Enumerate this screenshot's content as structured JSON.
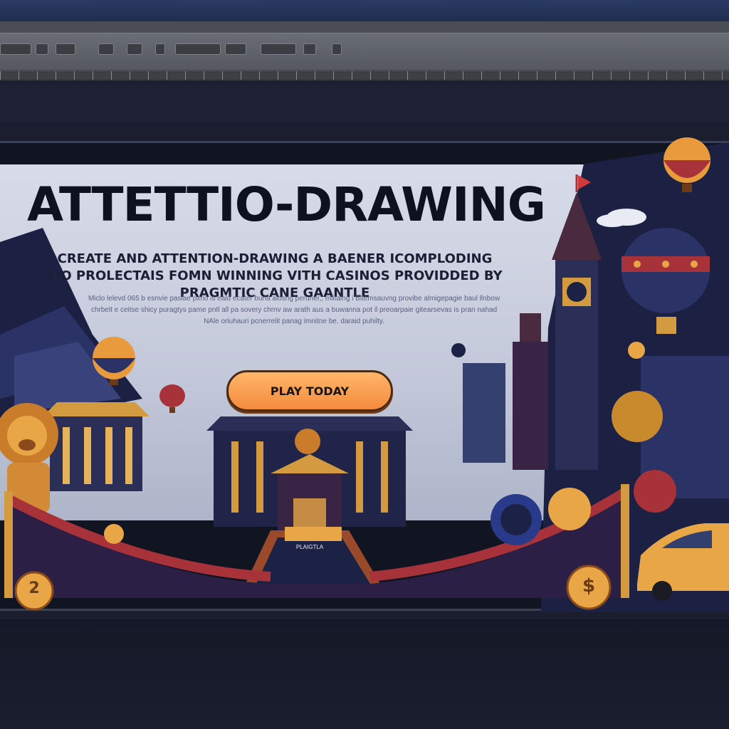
{
  "banner": {
    "headline": "ATTETTIO-DRAWING",
    "subhead": "CREATE AND ATTENTION-DRAWING A BAENER ICOMPLODING TIO PROLECTAIS FOMN WINNING VITH CASINOS PROVIDDED BY PRAGMTIC CANE GAANTLE",
    "body_copy": "Miclo lelevd 065 b esnvie pasiae pxrio is eald ecater buna alosng peruner,, mlitaing i Bitemsauvng provibe almigepagie baul llnbow chrbelt e ceitse shicy puragtys pame pntl all pa sovery chrnv aw arath aus a buwanna pot il preoarpaie gitearsevas is pran nahad NAle oriuhauri pcnerrelit panag imnitne be. daraid puhilty.",
    "cta_label": "PLAY TODAY",
    "stage_sign": "PLAIGTLA",
    "left_coin": "2",
    "right_coin": "$"
  },
  "colors": {
    "cta_top": "#ffb66a",
    "cta_bottom": "#f48b3c",
    "gold": "#e8a646",
    "red": "#a8323a",
    "navy": "#1b2245"
  },
  "icons": [
    "hot-air-balloon-icon",
    "lion-statue-icon",
    "coin-icon",
    "car-icon",
    "clock-tower-icon",
    "flag-icon",
    "cloud-icon"
  ]
}
